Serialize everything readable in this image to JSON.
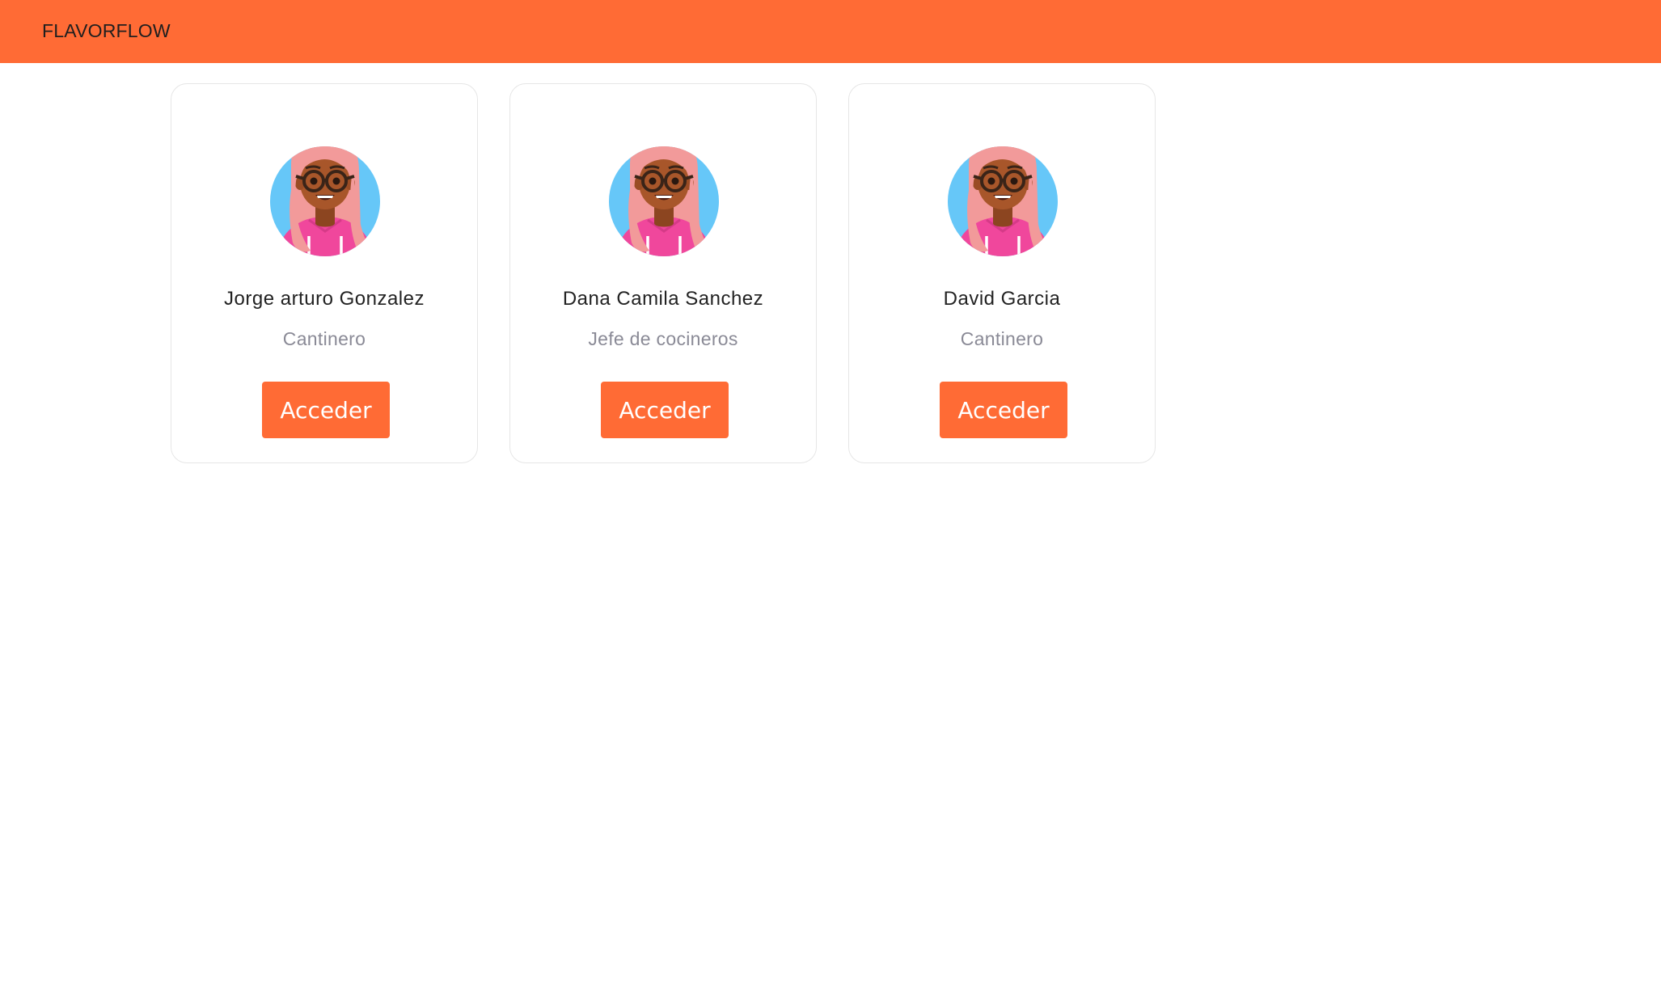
{
  "header": {
    "brand": "FLAVORFLOW",
    "background_color": "#ff6b35"
  },
  "cards": [
    {
      "name": "Jorge arturo Gonzalez",
      "role": "Cantinero",
      "button_label": "Acceder",
      "avatar_icon": "woman-glasses-avatar-icon"
    },
    {
      "name": "Dana Camila Sanchez",
      "role": "Jefe de cocineros",
      "button_label": "Acceder",
      "avatar_icon": "woman-glasses-avatar-icon"
    },
    {
      "name": "David Garcia",
      "role": "Cantinero",
      "button_label": "Acceder",
      "avatar_icon": "woman-glasses-avatar-icon"
    }
  ],
  "colors": {
    "accent": "#ff6b35",
    "avatar_bg": "#66c7f8",
    "hair": "#f29a9a",
    "shirt": "#f0479c",
    "skin": "#a8562a"
  }
}
